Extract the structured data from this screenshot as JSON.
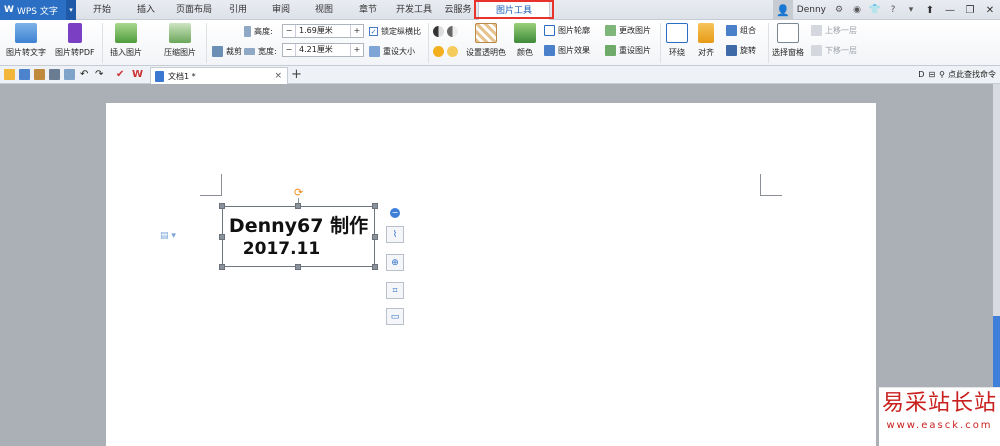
{
  "app": {
    "name": "WPS 文字"
  },
  "menu": {
    "tabs": [
      "开始",
      "插入",
      "页面布局",
      "引用",
      "审阅",
      "视图",
      "章节",
      "开发工具",
      "云服务",
      "图片工具"
    ],
    "active_tab": "图片工具"
  },
  "user": {
    "name": "Denny"
  },
  "ribbon": {
    "pic_to_text": "图片转文字",
    "pic_to_pdf": "图片转PDF",
    "insert_picture": "插入图片",
    "compress_picture": "压缩图片",
    "crop": "裁剪",
    "height_label": "高度:",
    "height_value": "1.69厘米",
    "width_label": "宽度:",
    "width_value": "4.21厘米",
    "lock_ratio": "锁定纵横比",
    "reset_size": "重设大小",
    "set_transparent": "设置透明色",
    "color": "颜色",
    "picture_outline": "图片轮廓",
    "picture_effect": "图片效果",
    "change_picture": "更改图片",
    "reset_picture": "重设图片",
    "wrap": "环绕",
    "align": "对齐",
    "group": "组合",
    "rotate": "旋转",
    "selection_pane": "选择窗格",
    "bring_forward": "上移一层",
    "send_backward": "下移一层",
    "spin_minus": "−",
    "spin_plus": "+"
  },
  "tabbar": {
    "doc_name": "文档1 *",
    "close": "×",
    "add": "+",
    "find_command": "点此查找命令"
  },
  "document": {
    "picture_line1": "Denny67 制作",
    "picture_line2": "2017.11"
  },
  "watermark": {
    "cn": "易采站长站",
    "url": "www.easck.com"
  },
  "colors": {
    "accent": "#2b6fc4",
    "highlight_border": "#e8322c",
    "watermark": "#c8201e"
  }
}
